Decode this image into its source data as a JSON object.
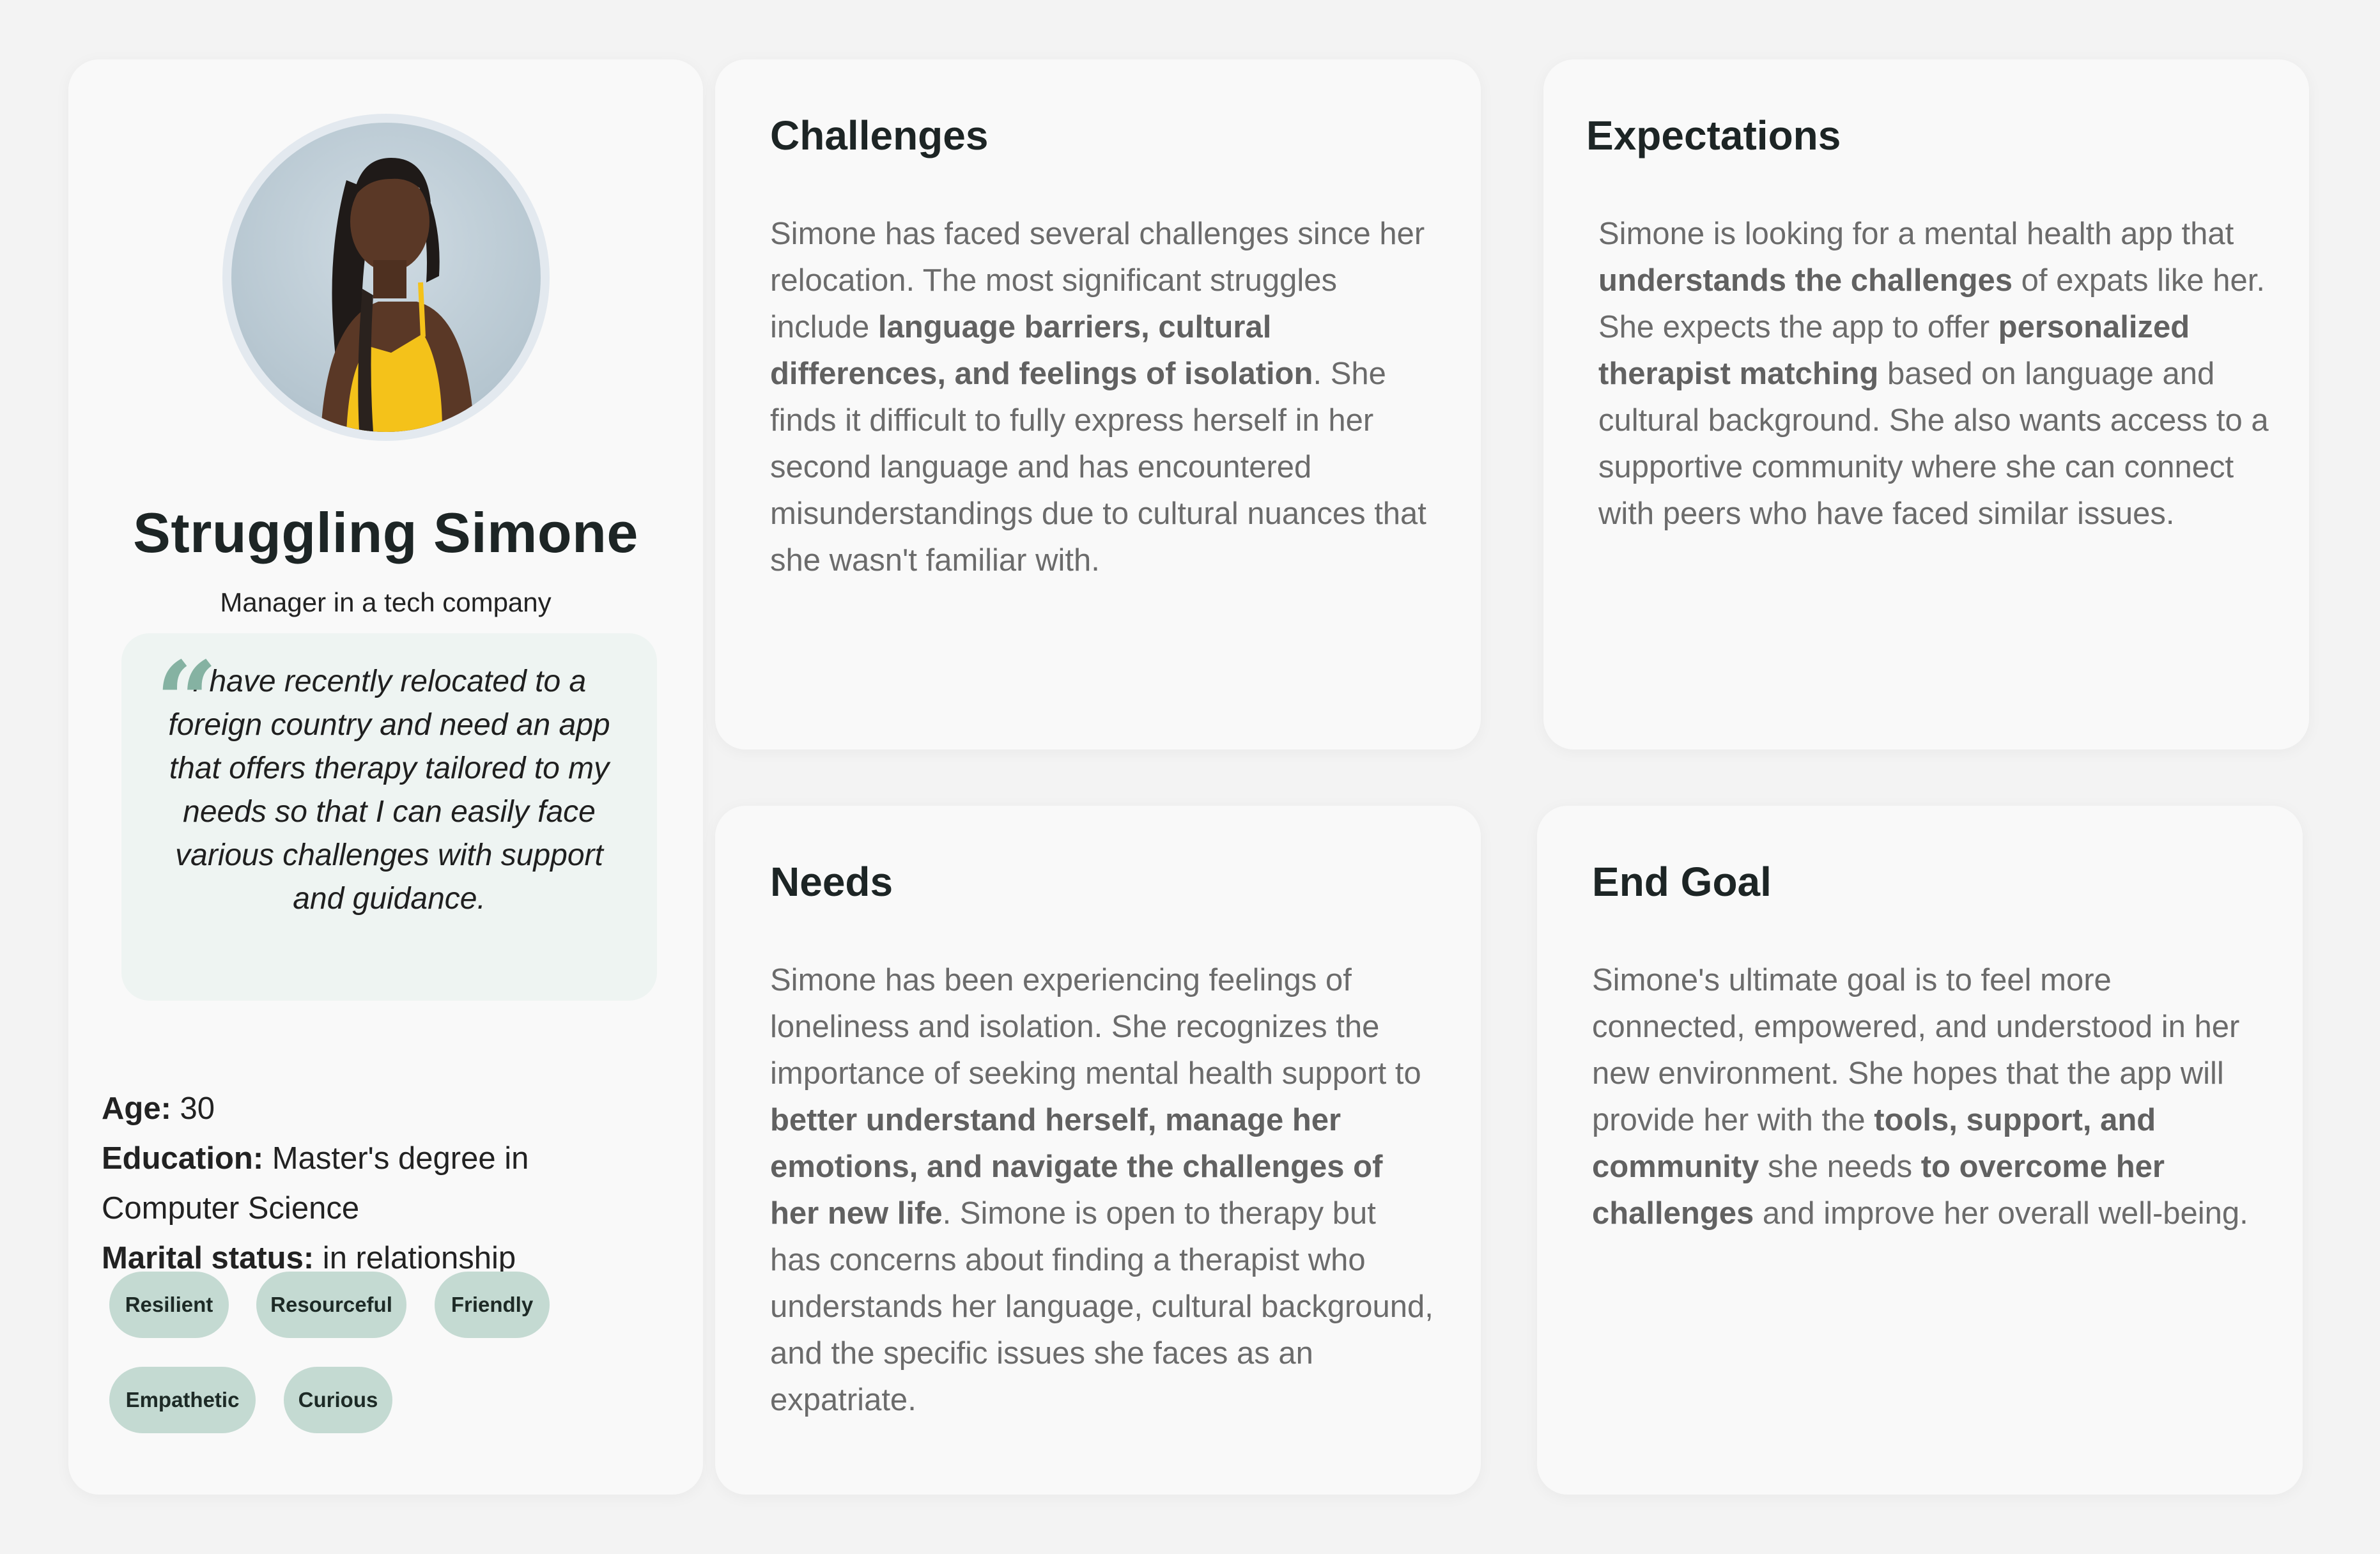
{
  "profile": {
    "name": "Struggling Simone",
    "role": "Manager in a tech company",
    "quote_mark": "“",
    "quote": "I have recently relocated to a foreign country and need an app that offers therapy tailored to my needs so that I can easily face various challenges with support and guidance.",
    "facts": [
      {
        "label": "Age:",
        "value": " 30"
      },
      {
        "label": "Education:",
        "value": " Master's degree in Computer Science"
      },
      {
        "label": "Marital status:",
        "value": " in relationship"
      }
    ],
    "tags": [
      "Resilient",
      "Resourceful",
      "Friendly",
      "Empathetic",
      "Curious"
    ]
  },
  "challenges": {
    "title": "Challenges",
    "body": [
      {
        "t": "Simone has faced several challenges since her relocation. The most significant struggles include ",
        "b": false
      },
      {
        "t": "language barriers, cultural differences, and feelings of isolation",
        "b": true
      },
      {
        "t": ". She finds it difficult to fully express herself in her second language and has encountered misunderstandings due to cultural nuances that she wasn't familiar with.",
        "b": false
      }
    ]
  },
  "expectations": {
    "title": "Expectations",
    "body": [
      {
        "t": "Simone is looking for a mental health app that ",
        "b": false
      },
      {
        "t": "understands the challenges",
        "b": true
      },
      {
        "t": " of expats like her. She expects the app to offer ",
        "b": false
      },
      {
        "t": "personalized therapist matching",
        "b": true
      },
      {
        "t": " based on language and cultural background. She also wants access to a supportive community where she can connect with peers who have faced similar issues.",
        "b": false
      }
    ]
  },
  "needs": {
    "title": "Needs",
    "body": [
      {
        "t": "Simone has been experiencing feelings of loneliness and isolation. She recognizes the importance of seeking mental health support to ",
        "b": false
      },
      {
        "t": "better understand herself, manage her emotions, and navigate the challenges of her new life",
        "b": true
      },
      {
        "t": ". Simone is open to therapy but has concerns about finding a therapist who understands her language, cultural background, and the specific issues she faces as an expatriate.",
        "b": false
      }
    ]
  },
  "endgoal": {
    "title": "End Goal",
    "body": [
      {
        "t": "Simone's ultimate goal is to feel more connected, empowered, and understood in her new environment. She hopes that the app will provide her with the ",
        "b": false
      },
      {
        "t": "tools, support, and community",
        "b": true
      },
      {
        "t": " she needs ",
        "b": false
      },
      {
        "t": "to overcome her challenges",
        "b": true
      },
      {
        "t": " and improve her overall well-being.",
        "b": false
      }
    ]
  },
  "colors": {
    "background": "#f3f3f3",
    "card": "#f9f9f9",
    "quote_box": "#eef4f2",
    "quote_mark": "#85b2a2",
    "tag": "#c4dad2",
    "heading": "#1d2525",
    "body_text": "#6b6b6b"
  }
}
